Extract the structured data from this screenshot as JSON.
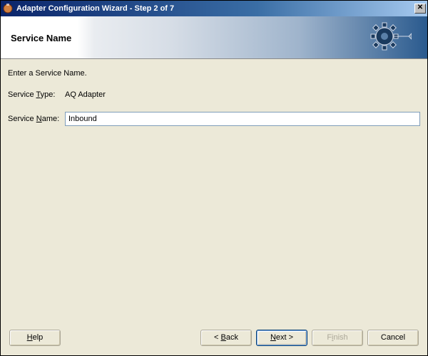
{
  "window": {
    "title": "Adapter Configuration Wizard - Step 2 of 7",
    "close_symbol": "✕"
  },
  "banner": {
    "page_title": "Service Name"
  },
  "content": {
    "instruction": "Enter a Service Name.",
    "service_type_label_pre": "Service ",
    "service_type_label_key": "T",
    "service_type_label_post": "ype:",
    "service_type_value": "AQ Adapter",
    "service_name_label_pre": "Service ",
    "service_name_label_key": "N",
    "service_name_label_post": "ame:",
    "service_name_value": "Inbound"
  },
  "buttons": {
    "help_key": "H",
    "help_post": "elp",
    "back_pre": "< ",
    "back_key": "B",
    "back_post": "ack",
    "next_key": "N",
    "next_post": "ext >",
    "finish_pre": "F",
    "finish_key": "i",
    "finish_post": "nish",
    "cancel": "Cancel"
  }
}
